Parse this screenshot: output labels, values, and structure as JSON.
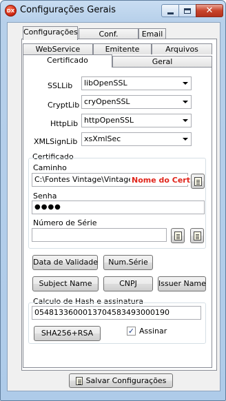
{
  "window": {
    "title": "Configurações Gerais",
    "app_icon_text": "DX"
  },
  "top_tabs": [
    "Configurações",
    "Conf. Impressora",
    "Email"
  ],
  "sub_tabs_row1": [
    "WebService",
    "Emitente",
    "Arquivos"
  ],
  "sub_tabs_row2": [
    "Certificado",
    "Geral"
  ],
  "libs": {
    "ssl": {
      "label": "SSLLib",
      "value": "libOpenSSL"
    },
    "crypt": {
      "label": "CryptLib",
      "value": "cryOpenSSL"
    },
    "http": {
      "label": "HttpLib",
      "value": "httpOpenSSL"
    },
    "xmlsign": {
      "label": "XMLSignLib",
      "value": "xsXmlSec"
    }
  },
  "certificado": {
    "group_label": "Certificado",
    "caminho_label": "Caminho",
    "caminho_value": "C:\\Fontes Vintage\\Vintage\\",
    "caminho_overlay": "Nome do Cert.",
    "senha_label": "Senha",
    "senha_value": "●●●●",
    "serie_label": "Número de Série",
    "serie_value": ""
  },
  "buttons": {
    "data_validade": "Data de Validade",
    "num_serie": "Num.Série",
    "subject_name": "Subject Name",
    "cnpj": "CNPJ",
    "issuer_name": "Issuer Name",
    "sha256": "SHA256+RSA",
    "salvar": "Salvar Configurações"
  },
  "hash": {
    "group_label": "Calculo de Hash e assinatura",
    "value": "05481336000137045834930001​90",
    "assinar_label": "Assinar",
    "assinar_checked": true,
    "check_mark": "✓"
  },
  "colors": {
    "overlay_red": "#e0251b"
  }
}
